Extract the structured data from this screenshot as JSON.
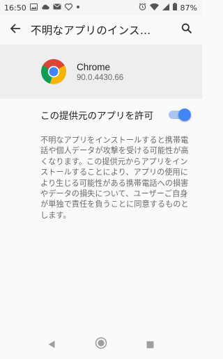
{
  "status_bar": {
    "time": "16:50",
    "battery": "87%",
    "left_icons": [
      "image-icon",
      "cloud-icon",
      "mail-icon",
      "heart-icon",
      "dot-icon"
    ],
    "right_icons": [
      "alarm-icon",
      "wifi-icon",
      "signal-icon",
      "battery-icon"
    ]
  },
  "app_bar": {
    "title": "不明なアプリのインス…"
  },
  "app": {
    "name": "Chrome",
    "version": "90.0.4430.66"
  },
  "setting": {
    "label": "この提供元のアプリを許可",
    "enabled": true,
    "accent_color": "#4285f4"
  },
  "description": "不明なアプリをインストールすると携帯電話や個人データが攻撃を受ける可能性が高くなります。この提供元からアプリをインストールすることにより、アプリの使用により生じる可能性がある携帯電話への損害やデータの損失について、ユーザーご自身が単独で責任を負うことに同意するものとします。",
  "nav_bar": {
    "buttons": [
      "back-icon",
      "home-icon",
      "recents-icon"
    ]
  }
}
